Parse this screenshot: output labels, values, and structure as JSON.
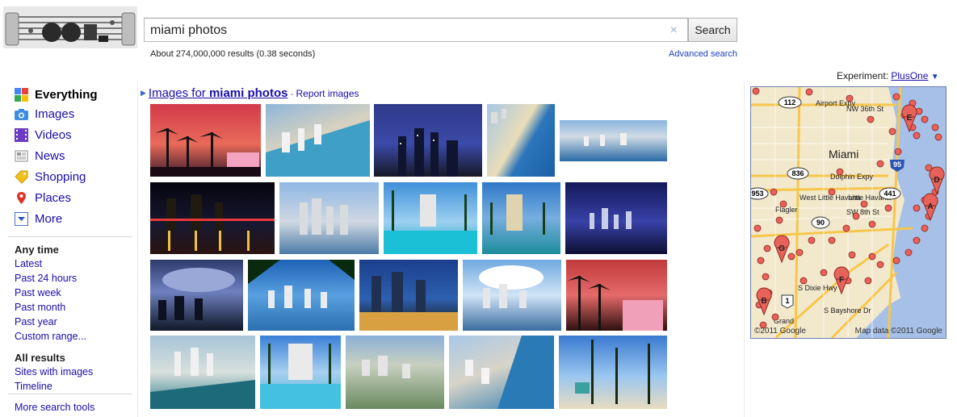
{
  "search": {
    "query": "miami photos",
    "button_label": "Search",
    "clear_icon": "×",
    "result_stats": "About 274,000,000 results (0.38 seconds)",
    "advanced_search": "Advanced search"
  },
  "nav": {
    "items": [
      {
        "label": "Everything",
        "icon": "everything-icon",
        "active": true
      },
      {
        "label": "Images",
        "icon": "camera-icon"
      },
      {
        "label": "Videos",
        "icon": "film-icon"
      },
      {
        "label": "News",
        "icon": "newspaper-icon"
      },
      {
        "label": "Shopping",
        "icon": "tag-icon"
      },
      {
        "label": "Places",
        "icon": "pin-icon"
      },
      {
        "label": "More",
        "icon": "dropdown-icon"
      }
    ],
    "time_heading": "Any time",
    "time_options": [
      "Latest",
      "Past 24 hours",
      "Past week",
      "Past month",
      "Past year",
      "Custom range..."
    ],
    "results_heading": "All results",
    "result_options": [
      "Sites with images",
      "Timeline"
    ],
    "more_tools": "More search tools"
  },
  "images_block": {
    "prefix": "Images for ",
    "query_bold": "miami photos",
    "separator": "-",
    "report": "Report images"
  },
  "right": {
    "experiment_label": "Experiment:",
    "experiment_link": "PlusOne",
    "experiment_arrow": "▼",
    "map_copyright": "©2011 Google",
    "map_data": "Map data ©2011 Google",
    "map_labels": [
      "Airport Expy",
      "NW 36th St",
      "Miami",
      "Dolphin Expy",
      "West Little Havana",
      "Little Havana",
      "SW 8th St",
      "Flagler",
      "S Dixie Hwy",
      "S Bayshore Dr",
      "Grand"
    ],
    "map_shields": [
      "112",
      "836",
      "95",
      "441",
      "953",
      "90",
      "1"
    ],
    "markers": [
      "A",
      "B",
      "D",
      "E",
      "F",
      "G"
    ]
  },
  "colors": {
    "link": "#1a0dab",
    "marker": "#e8625b",
    "map_road": "#f7c64b"
  }
}
